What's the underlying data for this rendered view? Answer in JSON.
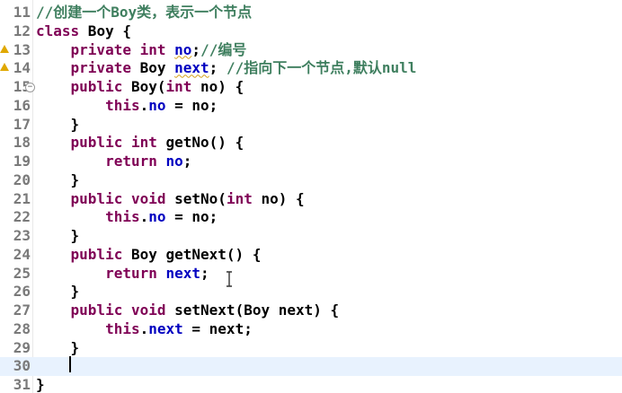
{
  "editor": {
    "lines": [
      {
        "n": "11",
        "parts": [
          {
            "t": "//创建一个Boy类，表示一个节点",
            "c": "cm"
          }
        ]
      },
      {
        "n": "12",
        "parts": [
          {
            "t": "class",
            "c": "kw"
          },
          {
            "t": " Boy {",
            "c": ""
          }
        ]
      },
      {
        "n": "13",
        "marker": true,
        "parts": [
          {
            "t": "    ",
            "c": ""
          },
          {
            "t": "private",
            "c": "kw"
          },
          {
            "t": " ",
            "c": ""
          },
          {
            "t": "int",
            "c": "kw"
          },
          {
            "t": " ",
            "c": ""
          },
          {
            "t": "no",
            "c": "fd warn"
          },
          {
            "t": ";",
            "c": ""
          },
          {
            "t": "//编号",
            "c": "cm"
          }
        ]
      },
      {
        "n": "14",
        "marker": true,
        "parts": [
          {
            "t": "    ",
            "c": ""
          },
          {
            "t": "private",
            "c": "kw"
          },
          {
            "t": " Boy ",
            "c": ""
          },
          {
            "t": "next",
            "c": "fd warn"
          },
          {
            "t": "; ",
            "c": ""
          },
          {
            "t": "//指向下一个节点,默认null",
            "c": "cm"
          }
        ]
      },
      {
        "n": "15",
        "fold": true,
        "parts": [
          {
            "t": "    ",
            "c": ""
          },
          {
            "t": "public",
            "c": "kw"
          },
          {
            "t": " Boy(",
            "c": ""
          },
          {
            "t": "int",
            "c": "kw"
          },
          {
            "t": " no) {",
            "c": ""
          }
        ]
      },
      {
        "n": "16",
        "parts": [
          {
            "t": "        ",
            "c": ""
          },
          {
            "t": "this",
            "c": "kw"
          },
          {
            "t": ".",
            "c": ""
          },
          {
            "t": "no",
            "c": "fd"
          },
          {
            "t": " = no;",
            "c": ""
          }
        ]
      },
      {
        "n": "17",
        "parts": [
          {
            "t": "    }",
            "c": ""
          }
        ]
      },
      {
        "n": "18",
        "parts": [
          {
            "t": "    ",
            "c": ""
          },
          {
            "t": "public",
            "c": "kw"
          },
          {
            "t": " ",
            "c": ""
          },
          {
            "t": "int",
            "c": "kw"
          },
          {
            "t": " getNo() {",
            "c": ""
          }
        ]
      },
      {
        "n": "19",
        "parts": [
          {
            "t": "        ",
            "c": ""
          },
          {
            "t": "return",
            "c": "kw"
          },
          {
            "t": " ",
            "c": ""
          },
          {
            "t": "no",
            "c": "fd"
          },
          {
            "t": ";",
            "c": ""
          }
        ]
      },
      {
        "n": "20",
        "parts": [
          {
            "t": "    }",
            "c": ""
          }
        ]
      },
      {
        "n": "21",
        "parts": [
          {
            "t": "    ",
            "c": ""
          },
          {
            "t": "public",
            "c": "kw"
          },
          {
            "t": " ",
            "c": ""
          },
          {
            "t": "void",
            "c": "kw"
          },
          {
            "t": " setNo(",
            "c": ""
          },
          {
            "t": "int",
            "c": "kw"
          },
          {
            "t": " no) {",
            "c": ""
          }
        ]
      },
      {
        "n": "22",
        "parts": [
          {
            "t": "        ",
            "c": ""
          },
          {
            "t": "this",
            "c": "kw"
          },
          {
            "t": ".",
            "c": ""
          },
          {
            "t": "no",
            "c": "fd"
          },
          {
            "t": " = no;",
            "c": ""
          }
        ]
      },
      {
        "n": "23",
        "parts": [
          {
            "t": "    }",
            "c": ""
          }
        ]
      },
      {
        "n": "24",
        "parts": [
          {
            "t": "    ",
            "c": ""
          },
          {
            "t": "public",
            "c": "kw"
          },
          {
            "t": " Boy getNext() {",
            "c": ""
          }
        ]
      },
      {
        "n": "25",
        "parts": [
          {
            "t": "        ",
            "c": ""
          },
          {
            "t": "return",
            "c": "kw"
          },
          {
            "t": " ",
            "c": ""
          },
          {
            "t": "next",
            "c": "fd"
          },
          {
            "t": ";",
            "c": ""
          }
        ]
      },
      {
        "n": "26",
        "parts": [
          {
            "t": "    }",
            "c": ""
          }
        ]
      },
      {
        "n": "27",
        "parts": [
          {
            "t": "    ",
            "c": ""
          },
          {
            "t": "public",
            "c": "kw"
          },
          {
            "t": " ",
            "c": ""
          },
          {
            "t": "void",
            "c": "kw"
          },
          {
            "t": " setNext(Boy next) {",
            "c": ""
          }
        ]
      },
      {
        "n": "28",
        "parts": [
          {
            "t": "        ",
            "c": ""
          },
          {
            "t": "this",
            "c": "kw"
          },
          {
            "t": ".",
            "c": ""
          },
          {
            "t": "next",
            "c": "fd"
          },
          {
            "t": " = next;",
            "c": ""
          }
        ]
      },
      {
        "n": "29",
        "parts": [
          {
            "t": "    }",
            "c": ""
          }
        ]
      },
      {
        "n": "30",
        "current": true,
        "parts": [
          {
            "t": "    ",
            "c": ""
          }
        ]
      },
      {
        "n": "31",
        "parts": [
          {
            "t": "}",
            "c": ""
          }
        ]
      }
    ],
    "colors": {
      "keyword": "#7f0055",
      "comment": "#3f7f5f",
      "field": "#0000c0",
      "current_line": "#e8f2fe",
      "warning": "#e0a800"
    }
  }
}
